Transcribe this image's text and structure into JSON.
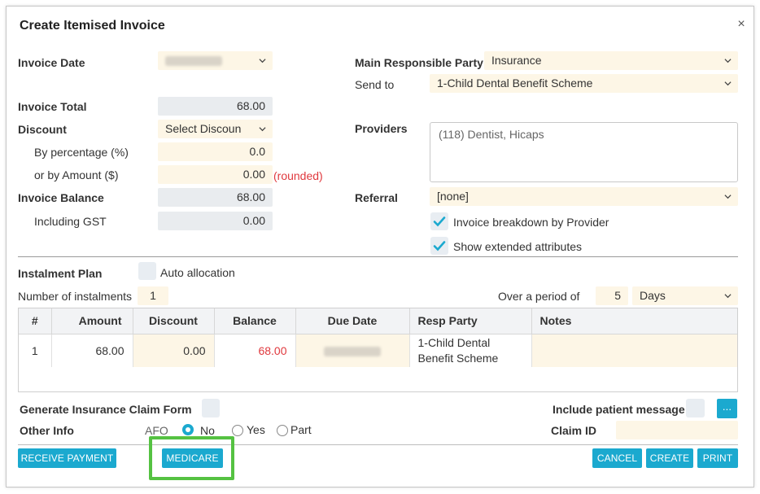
{
  "dialog": {
    "title": "Create Itemised Invoice",
    "close_icon": "×"
  },
  "left": {
    "invoice_date_label": "Invoice Date",
    "invoice_total_label": "Invoice Total",
    "invoice_total_value": "68.00",
    "discount_label": "Discount",
    "discount_select": "Select Discoun",
    "by_percentage_label": "By percentage (%)",
    "by_percentage_value": "0.0",
    "by_amount_label": "or by Amount ($)",
    "by_amount_value": "0.00",
    "rounded_note": "(rounded)",
    "invoice_balance_label": "Invoice Balance",
    "invoice_balance_value": "68.00",
    "including_gst_label": "Including GST",
    "including_gst_value": "0.00"
  },
  "right": {
    "main_party_label": "Main Responsible Party",
    "main_party_value": "Insurance",
    "send_to_label": "Send to",
    "send_to_value": "1-Child Dental Benefit Scheme",
    "providers_label": "Providers",
    "providers_value": "(118) Dentist, Hicaps",
    "referral_label": "Referral",
    "referral_value": "[none]",
    "breakdown_label": "Invoice breakdown by Provider",
    "extended_label": "Show extended attributes"
  },
  "instalment": {
    "plan_label": "Instalment Plan",
    "auto_allocation_label": "Auto allocation",
    "number_label": "Number of instalments",
    "number_value": "1",
    "period_label": "Over a period of",
    "period_value": "5",
    "period_unit": "Days"
  },
  "table": {
    "headers": [
      "#",
      "Amount",
      "Discount",
      "Balance",
      "Due Date",
      "Resp Party",
      "Notes"
    ],
    "rows": [
      {
        "num": "1",
        "amount": "68.00",
        "discount": "0.00",
        "balance": "68.00",
        "resp_party_line1": "1-Child Dental",
        "resp_party_line2": "Benefit Scheme",
        "notes": ""
      }
    ]
  },
  "footer": {
    "claim_form_label": "Generate Insurance Claim Form",
    "patient_message_label": "Include patient message",
    "more_button": "...",
    "other_info_label": "Other Info",
    "afo_label": "AFO",
    "radio_no": "No",
    "radio_yes": "Yes",
    "radio_part": "Part",
    "claim_id_label": "Claim ID"
  },
  "buttons": {
    "receive_payment": "RECEIVE PAYMENT",
    "medicare": "MEDICARE",
    "cancel": "CANCEL",
    "create": "CREATE",
    "print": "PRINT"
  },
  "colors": {
    "accent": "#1ba9cf",
    "field_yellow": "#fdf6e6",
    "field_grey": "#e9ecef",
    "negative_red": "#e0393e",
    "highlight_green": "#55c242"
  }
}
